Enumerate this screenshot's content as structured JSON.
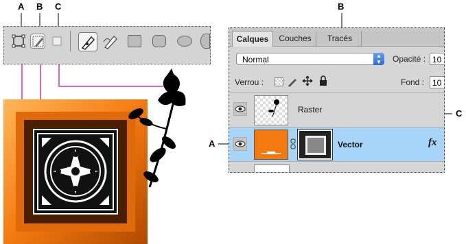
{
  "callouts": {
    "a_left": "A",
    "b_left": "B",
    "c_left": "C",
    "b_panel": "B",
    "c_panel": "C",
    "a_panel": "A"
  },
  "toolbar": {
    "icons": [
      "shape-layers-icon",
      "paths-icon",
      "fill-pixels-icon",
      "pen-tool-icon",
      "freeform-pen-icon",
      "rectangle-icon",
      "rounded-rectangle-icon",
      "ellipse-icon",
      "polygon-icon"
    ]
  },
  "panel": {
    "tabs": [
      "Calques",
      "Couches",
      "Tracés"
    ],
    "blend_mode": "Normal",
    "opacity_label": "Opacité :",
    "opacity_value": "10",
    "lock_label": "Verrou :",
    "fill_label": "Fond :",
    "fill_value": "10",
    "layers": [
      {
        "name": "Raster",
        "selected": false
      },
      {
        "name": "Vector",
        "selected": true,
        "fx": "fx"
      }
    ]
  },
  "colors": {
    "orange": "#f47a10",
    "selection": "#a7d4f7",
    "leader": "#d6339a"
  }
}
